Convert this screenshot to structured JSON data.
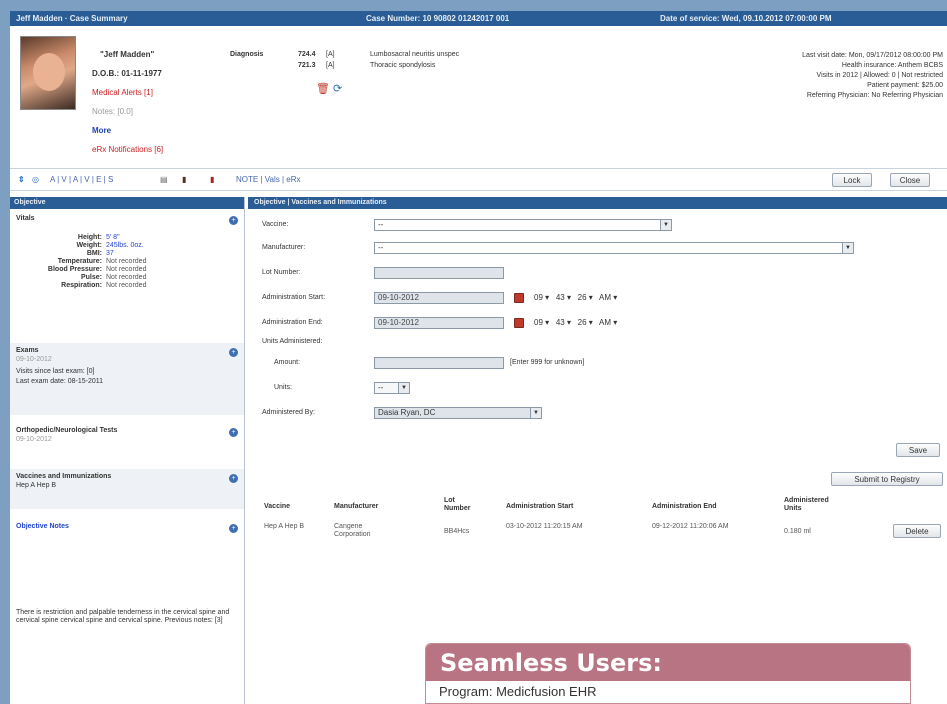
{
  "titlebar": {
    "left": "Jeff Madden · Case Summary",
    "center": "Case Number: 10 90802 01242017 001",
    "right": "Date of service: Wed, 09.10.2012 07:00:00 PM"
  },
  "patient": {
    "name": "\"Jeff Madden\"",
    "dob": "D.O.B.: 01-11-1977",
    "alerts": "Medical Alerts [1]",
    "notes": "Notes: [0.0]",
    "more": "More",
    "notifications": "eRx Notifications [6]",
    "diagnosis_label": "Diagnosis",
    "diagnoses": [
      {
        "code": "724.4",
        "flag": "[A]",
        "text": "Lumbosacral neuritis unspec"
      },
      {
        "code": "721.3",
        "flag": "[A]",
        "text": "Thoracic spondylosis"
      }
    ]
  },
  "right_info": [
    "Last visit date: Mon, 09/17/2012 08:00:00 PM",
    "Health insurance: Anthem BCBS",
    "Visits in 2012 | Allowed: 0 | Not restricted",
    "Patient payment: $25.00",
    "Referring Physician: No Referring Physician"
  ],
  "toolbar": {
    "links": "NOTE | Vals | eRx",
    "icon_strip": "A | V | A | V | E | S",
    "lock_label": "Lock",
    "close_label": "Close"
  },
  "left_panel": {
    "header": "Objective",
    "vitals_title": "Vitals",
    "vitals": [
      {
        "k": "Height:",
        "v": "5' 8\""
      },
      {
        "k": "Weight:",
        "v": "245lbs. 0oz."
      },
      {
        "k": "BMI:",
        "v": "37"
      },
      {
        "k": "Temperature:",
        "v": "Not recorded"
      },
      {
        "k": "Blood Pressure:",
        "v": "Not recorded"
      },
      {
        "k": "Pulse:",
        "v": "Not recorded"
      },
      {
        "k": "Respiration:",
        "v": "Not recorded"
      }
    ],
    "exams_title": "Exams",
    "exams_sub": "09-10-2012",
    "exams_visits": "Visits since last exam: [0]",
    "exams_last": "Last exam date: 08-15-2011",
    "ortho_title": "Orthopedic/Neurological Tests",
    "ortho_sub": "09-10-2012",
    "vacc_title": "Vaccines and Immunizations",
    "vacc_sub": "Hep A Hep B",
    "notes_title": "Objective Notes",
    "notes_text": "There is restriction and palpable tenderness in the cervical spine and cervical spine cervical spine and cervical spine. Previous notes: [3]"
  },
  "main_panel": {
    "header": "Objective | Vaccines and Immunizations",
    "fields": {
      "vaccine_label": "Vaccine:",
      "vaccine_value": "--",
      "manufacturer_label": "Manufacturer:",
      "manufacturer_value": "--",
      "lot_label": "Lot Number:",
      "lot_value": "",
      "admin_start_label": "Administration Start:",
      "admin_start_value": "09-10-2012",
      "admin_end_label": "Administration End:",
      "admin_end_value": "09-10-2012",
      "time_hour": "09",
      "time_min": "43",
      "time_sec": "26",
      "time_ampm": "AM",
      "units_label": "Units Administered:",
      "amount_label": "Amount:",
      "amount_hint": "[Enter 999 for unknown]",
      "units_sub_label": "Units:",
      "units_value": "--",
      "admin_by_label": "Administered By:",
      "admin_by_value": "Dasia Ryan, DC"
    },
    "save_label": "Save",
    "submit_label": "Submit to Registry",
    "table_headers": [
      "Vaccine",
      "Manufacturer",
      "Lot Number",
      "Administration Start",
      "Administration End",
      "Administered Units"
    ],
    "table_rows": [
      {
        "vaccine": "Hep A Hep B",
        "manufacturer": "Cangene Corporation",
        "lot": "BB4Hcs",
        "start": "03-10-2012 11:20:15 AM",
        "end": "09-12-2012 11:20:06 AM",
        "units": "0.180 ml"
      }
    ],
    "delete_label": "Delete"
  },
  "badge": {
    "title": "Seamless Users:",
    "subtitle": "Program: Medicfusion EHR"
  }
}
